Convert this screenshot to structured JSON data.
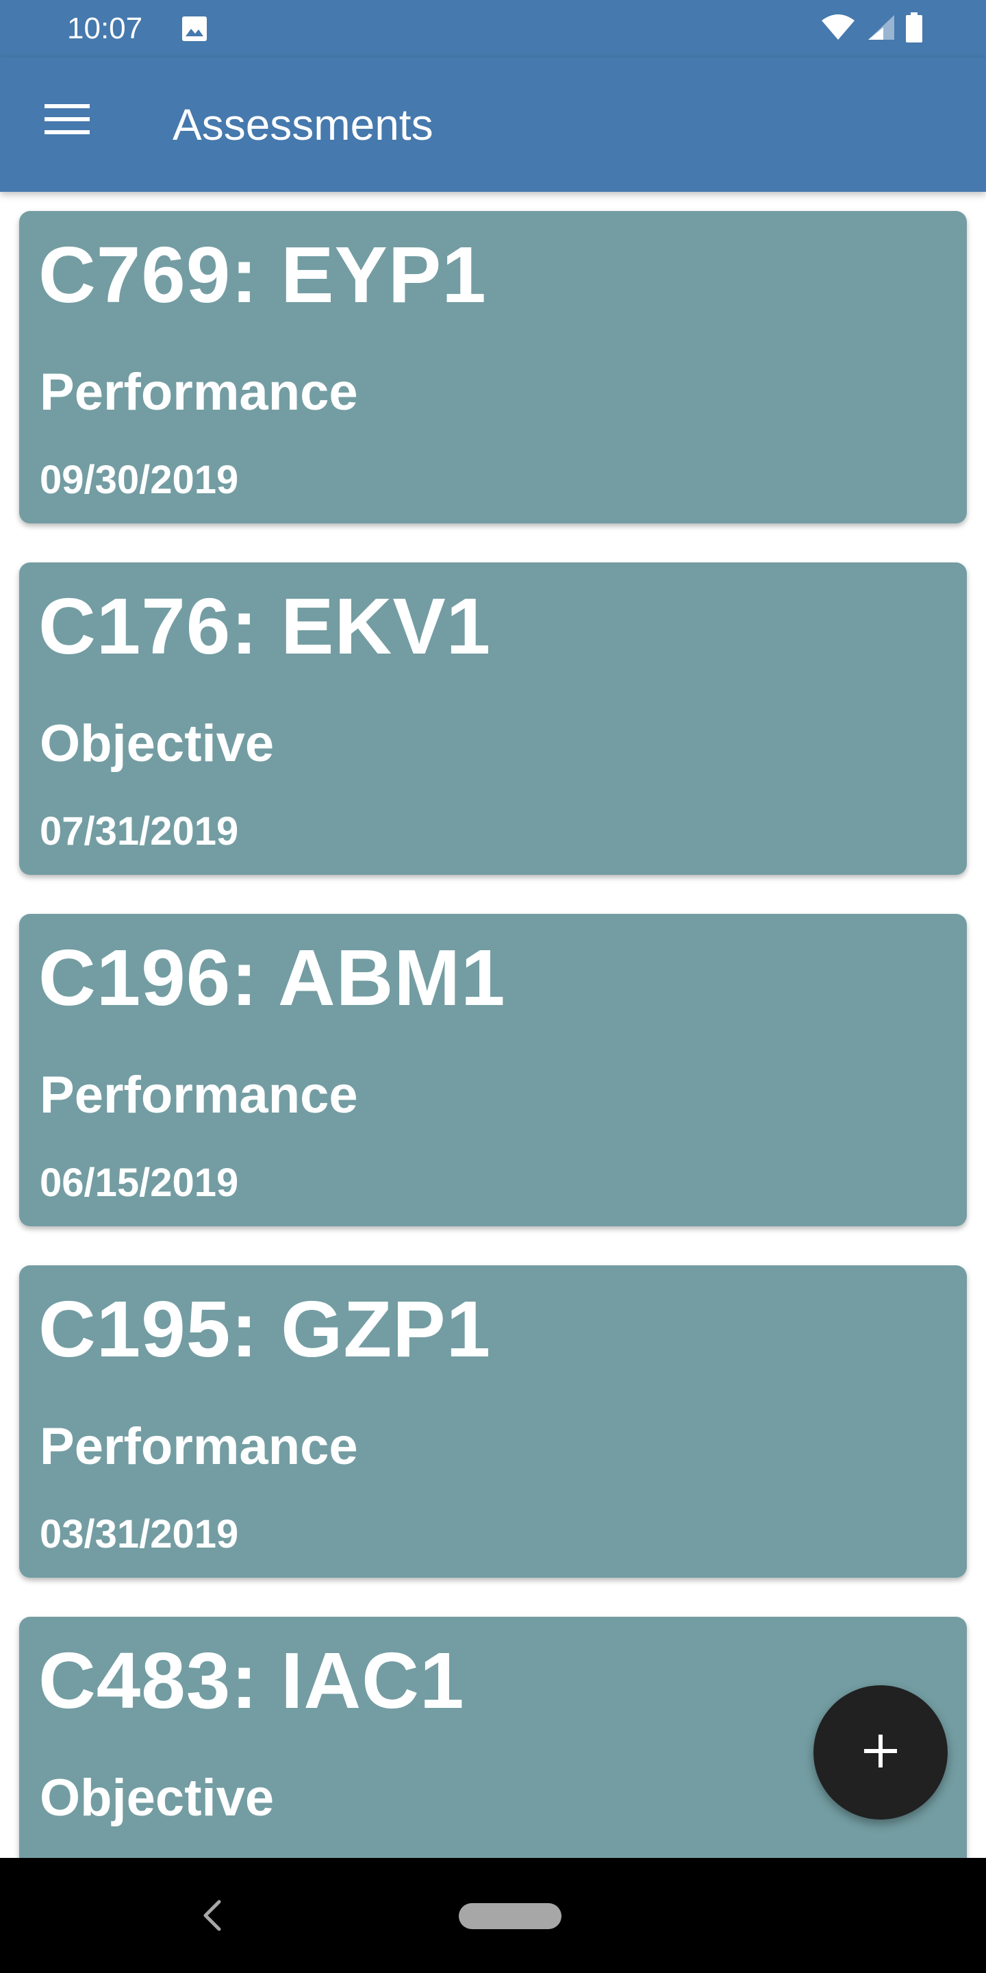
{
  "status_bar": {
    "time": "10:07",
    "icons": [
      "image-icon",
      "wifi-icon",
      "signal-icon",
      "battery-icon"
    ]
  },
  "app_bar": {
    "title": "Assessments",
    "menu_icon": "hamburger-menu-icon"
  },
  "assessments": [
    {
      "title": "C769: EYP1",
      "type": "Performance",
      "date": "09/30/2019"
    },
    {
      "title": "C176: EKV1",
      "type": "Objective",
      "date": "07/31/2019"
    },
    {
      "title": "C196: ABM1",
      "type": "Performance",
      "date": "06/15/2019"
    },
    {
      "title": "C195: GZP1",
      "type": "Performance",
      "date": "03/31/2019"
    },
    {
      "title": "C483: IAC1",
      "type": "Objective",
      "date": ""
    }
  ],
  "fab": {
    "icon": "plus-icon"
  },
  "nav_bar": {
    "icons": [
      "back-icon",
      "home-pill-icon"
    ]
  },
  "colors": {
    "primary": "#4679ad",
    "card": "#739da2",
    "fab": "#212121",
    "nav_bar": "#000000"
  }
}
